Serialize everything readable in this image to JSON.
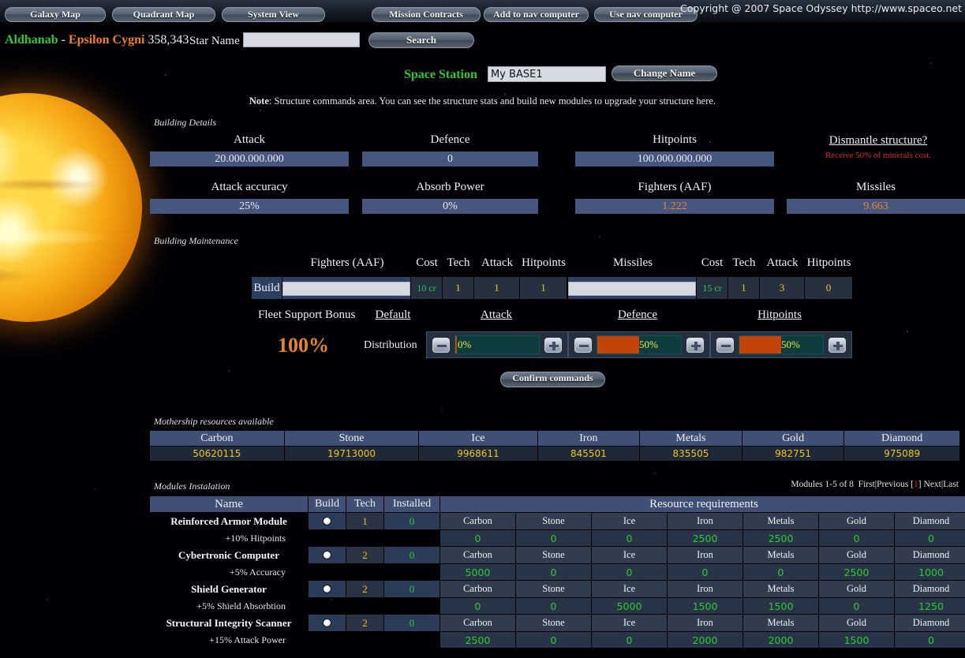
{
  "topnav": {
    "buttons": [
      {
        "label": "Galaxy Map"
      },
      {
        "label": "Quadrant Map"
      },
      {
        "label": "System View"
      },
      {
        "label": "Mission Contracts"
      },
      {
        "label": "Add to nav computer"
      },
      {
        "label": "Use nav computer"
      }
    ],
    "copyright": "Copyright @ 2007 Space Odyssey http://www.spaceo.net"
  },
  "starbar": {
    "star_name": "Aldhanab",
    "dash": "-",
    "constellation": "Epsilon Cygni",
    "coords": "358,343",
    "search_label": "Star Name",
    "search_value": "",
    "search_placeholder": "",
    "search_button": "Search"
  },
  "station": {
    "label": "Space Station",
    "name_value": "My BASE1",
    "change_button": "Change Name",
    "note_prefix": "Note",
    "note_text": ": Structure commands area. You can see the structure stats and build new modules to upgrade your structure here."
  },
  "building_details": {
    "caption": "Building Details",
    "stats": [
      {
        "label": "Attack",
        "value": "20.000.000.000"
      },
      {
        "label": "Defence",
        "value": "0"
      },
      {
        "label": "Hitpoints",
        "value": "100.000.000.000"
      },
      {
        "label": "Attack accuracy",
        "value": "25%"
      },
      {
        "label": "Absorb Power",
        "value": "0%"
      },
      {
        "label": "Fighters (AAF)",
        "value": "1.222"
      },
      {
        "label": "Missiles",
        "value": "9.663"
      }
    ],
    "dismantle_link": "Dismantle structure?",
    "dismantle_sub": "Receive 50% of minerals cost."
  },
  "building_maintenance": {
    "caption": "Building Maintenance",
    "build_label": "Build",
    "columns": [
      "Cost",
      "Tech",
      "Attack",
      "Hitpoints"
    ],
    "fighters": {
      "title": "Fighters (AAF)",
      "input_value": "",
      "cost": "10 cr",
      "tech": "1",
      "attack": "1",
      "hitpoints": "1"
    },
    "missiles": {
      "title": "Missiles",
      "input_value": "",
      "cost": "15 cr",
      "tech": "1",
      "attack": "3",
      "hitpoints": "0"
    }
  },
  "fleet_support": {
    "label": "Fleet Support Bonus",
    "value": "100%",
    "distribution_label": "Distribution",
    "default_link": "Default",
    "sliders": [
      {
        "title": "Attack",
        "percent": "0%",
        "fill": 2
      },
      {
        "title": "Defence",
        "percent": "50%",
        "fill": 50
      },
      {
        "title": "Hitpoints",
        "percent": "50%",
        "fill": 50
      }
    ],
    "confirm_button": "Confirm commands"
  },
  "resources": {
    "caption": "Mothership resources available",
    "headers": [
      "Carbon",
      "Stone",
      "Ice",
      "Iron",
      "Metals",
      "Gold",
      "Diamond"
    ],
    "values": [
      "50620115",
      "19713000",
      "9968611",
      "845501",
      "835505",
      "982751",
      "975089"
    ]
  },
  "modules": {
    "caption": "Modules Instalation",
    "pager": {
      "summary": "Modules 1-5 of 8",
      "first": "First",
      "previous": "Previous",
      "open_bracket": "[",
      "current": "1",
      "close_bracket": "]",
      "next": "Next",
      "last": "Last",
      "sep": "|"
    },
    "headers": {
      "name": "Name",
      "build": "Build",
      "tech": "Tech",
      "installed": "Installed",
      "requirements": "Resource requirements"
    },
    "resource_headers": [
      "Carbon",
      "Stone",
      "Ice",
      "Iron",
      "Metals",
      "Gold",
      "Diamond"
    ],
    "rows": [
      {
        "name": "Reinforced Armor Module",
        "bonus": "+10% Hitpoints",
        "tech": "1",
        "installed": "0",
        "costs": [
          "0",
          "0",
          "0",
          "2500",
          "2500",
          "0",
          "0"
        ]
      },
      {
        "name": "Cybertronic Computer",
        "bonus": "+5% Accuracy",
        "tech": "2",
        "installed": "0",
        "costs": [
          "5000",
          "0",
          "0",
          "0",
          "0",
          "2500",
          "1000"
        ]
      },
      {
        "name": "Shield Generator",
        "bonus": "+5% Shield Absorbtion",
        "tech": "2",
        "installed": "0",
        "costs": [
          "0",
          "0",
          "5000",
          "1500",
          "1500",
          "0",
          "1250"
        ]
      },
      {
        "name": "Structural Integrity Scanner",
        "bonus": "+15% Attack Power",
        "tech": "2",
        "installed": "0",
        "costs": [
          "2500",
          "0",
          "0",
          "2000",
          "2000",
          "1500",
          "0"
        ]
      }
    ]
  }
}
